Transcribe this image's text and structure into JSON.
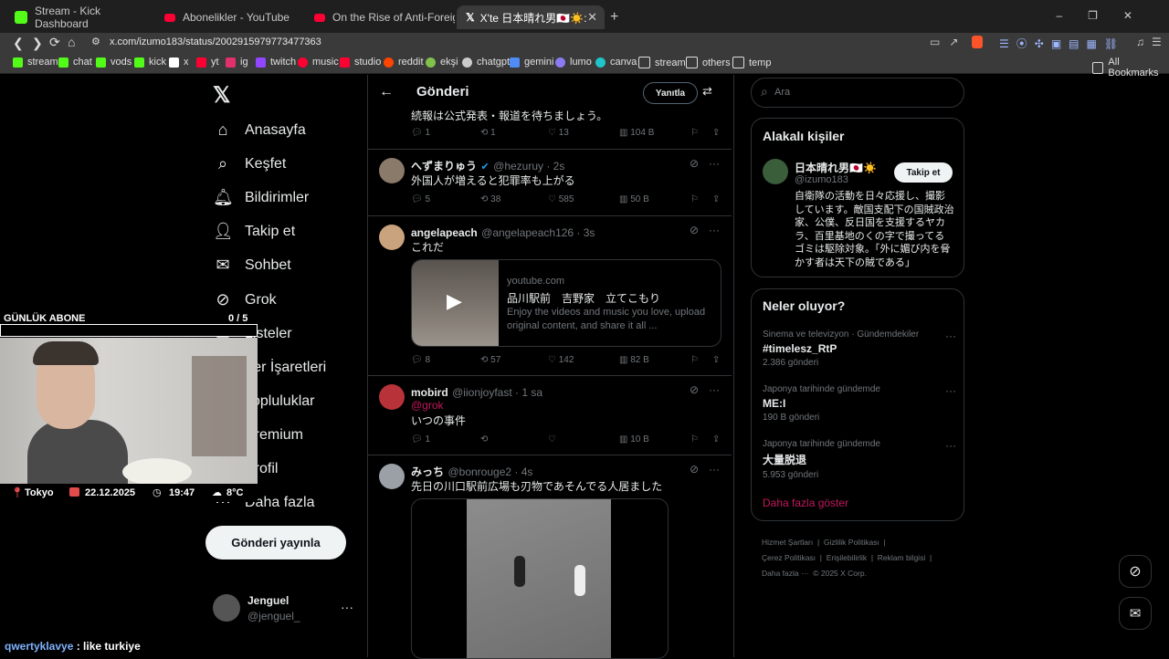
{
  "browser": {
    "tabs": [
      {
        "title": "Stream - Kick Dashboard",
        "color": "#53fc18"
      },
      {
        "title": "Abonelikler - YouTube",
        "color": "#ff0033"
      },
      {
        "title": "On the Rise of Anti-Foreigner Sentim",
        "color": "#ff0033"
      },
      {
        "title": "X'te 日本晴れ男🇯🇵☀️: \"品川駅游",
        "color": "#ffffff"
      }
    ],
    "new_tab": "+",
    "url": "x.com/izumo183/status/2002915979773477363",
    "bookmarks": [
      "stream",
      "chat",
      "vods",
      "kick",
      "x",
      "yt",
      "ig",
      "twitch",
      "music",
      "studio",
      "reddit",
      "ekşi",
      "chatgpt",
      "gemini",
      "lumo",
      "canva",
      "stream",
      "others",
      "temp"
    ],
    "all_bookmarks": "All Bookmarks"
  },
  "nav": {
    "items": [
      "Anasayfa",
      "Keşfet",
      "Bildirimler",
      "Takip et",
      "Sohbet",
      "Grok",
      "Listeler",
      "Yer İşaretleri",
      "Topluluklar",
      "Premium",
      "Profil",
      "Daha fazla"
    ],
    "post_button": "Gönderi yayınla",
    "account_name": "Jenguel",
    "account_handle": "@jenguel_"
  },
  "header": {
    "title": "Gönderi",
    "reply_button": "Yanıtla"
  },
  "top_snippet": {
    "text": "続報は公式発表・報道を待ちましょう。",
    "replies": "1",
    "reposts": "1",
    "likes": "13",
    "views": "104 B"
  },
  "tweets": [
    {
      "name": "へずまりゅう",
      "handle": "@hezuruy · 2s",
      "text": "外国人が増えると犯罪率も上がる",
      "replies": "5",
      "reposts": "38",
      "likes": "585",
      "views": "50 B"
    },
    {
      "name": "angelapeach",
      "handle": "@angelapeach126 · 3s",
      "text": "これだ",
      "replies": "8",
      "reposts": "57",
      "likes": "142",
      "views": "82 B",
      "card": {
        "domain": "youtube.com",
        "title": "品川駅前　吉野家　立てこもり",
        "desc": "Enjoy the videos and music you love, upload original content, and share it all ..."
      }
    },
    {
      "name": "mobird",
      "handle": "@iionjoyfast · 1 sa",
      "mention": "@grok",
      "text": "いつの事件",
      "replies": "1",
      "reposts": "",
      "likes": "",
      "views": "10 B"
    },
    {
      "name": "みっち",
      "handle": "@bonrouge2 · 4s",
      "text": "先日の川口駅前広場も刃物であそんでる人居ました"
    }
  ],
  "search": {
    "placeholder": "Ara"
  },
  "related": {
    "title": "Alakalı kişiler",
    "name": "日本晴れ男🇯🇵☀️",
    "handle": "@izumo183",
    "follow": "Takip et",
    "bio": "自衛隊の活動を日々応援し、撮影しています。敵国支配下の国賊政治家、公僕、反日国を支援するヤカラ、百里基地のくの字で撮ってるゴミは駆除対象。「外に媚び内を脅かす者は天下の賊である」"
  },
  "trends": {
    "title": "Neler oluyor?",
    "items": [
      {
        "meta": "Sinema ve televizyon · Gündemdekiler",
        "name": "#timelesz_RtP",
        "count": "2.386 gönderi"
      },
      {
        "meta": "Japonya tarihinde gündemde",
        "name": "ME:I",
        "count": "190 B gönderi"
      },
      {
        "meta": "Japonya tarihinde gündemde",
        "name": "大量脱退",
        "count": "5.953 gönderi"
      }
    ],
    "show_more": "Daha fazla göster"
  },
  "footer": {
    "links": [
      "Hizmet Şartları",
      "Gizlilik Politikası",
      "Çerez Politikası",
      "Erişilebilirlik",
      "Reklam bilgisi",
      "Daha fazla ···",
      "© 2025 X Corp."
    ]
  },
  "overlay": {
    "sub_title": "GÜNLÜK ABONE",
    "sub_count": "0 / 5",
    "sub_progress": 0,
    "location": "Tokyo",
    "date": "22.12.2025",
    "time": "19:47",
    "temp": "8°C",
    "chat_user": "qwertyklavye",
    "chat_msg": " : like turkiye"
  }
}
